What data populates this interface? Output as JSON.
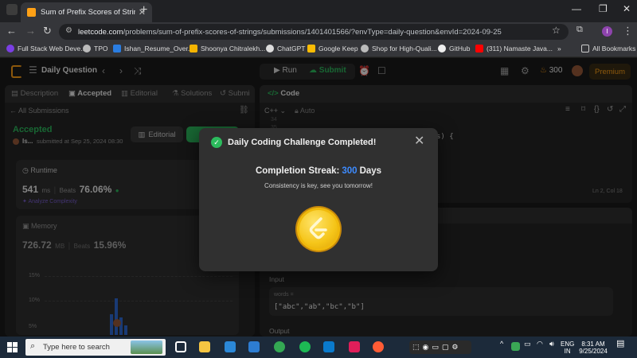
{
  "browser": {
    "tab_title": "Sum of Prefix Scores of Strings",
    "url_host": "leetcode.com",
    "url_path": "/problems/sum-of-prefix-scores-of-strings/submissions/1401401566/?envType=daily-question&envId=2024-09-25",
    "bookmarks": [
      "Full Stack Web Deve...",
      "TPO",
      "Ishan_Resume_Over...",
      "Shoonya Chitralekh...",
      "ChatGPT",
      "Google Keep",
      "Shop for High-Quali...",
      "GitHub",
      "(311) Namaste Java..."
    ],
    "all_bookmarks": "All Bookmarks",
    "more": "»"
  },
  "header": {
    "daily_question": "Daily Question",
    "run": "Run",
    "submit": "Submit",
    "streak_count": "300",
    "premium": "Premium"
  },
  "left_panel": {
    "tabs": [
      "Description",
      "Accepted",
      "Editorial",
      "Solutions",
      "Submi"
    ],
    "all_submissions": "All Submissions",
    "status": "Accepted",
    "user": "Is...",
    "submitted_at": "submitted at Sep 25, 2024 08:30",
    "editorial_btn": "Editorial",
    "runtime_label": "Runtime",
    "runtime_value": "541",
    "runtime_unit": "ms",
    "beats_label": "Beats",
    "runtime_beats": "76.06%",
    "analyze": "Analyze Complexity",
    "memory_label": "Memory",
    "memory_value": "726.72",
    "memory_unit": "MB",
    "memory_beats": "15.96%",
    "axis_ticks": [
      "15%",
      "10%",
      "5%"
    ]
  },
  "right_panel": {
    "code_tab": "Code",
    "language": "C++",
    "auto": "Auto",
    "line_numbers": [
      "34",
      "35"
    ],
    "code_fragment": "s) {",
    "cursor_pos": "Ln 2, Col 18",
    "input_label": "Input",
    "words_label": "words =",
    "words_value": "[\"abc\",\"ab\",\"bc\",\"b\"]",
    "output_label": "Output"
  },
  "modal": {
    "title": "Daily Coding Challenge Completed!",
    "streak_prefix": "Completion Streak:",
    "streak_value": "300",
    "streak_suffix": "Days",
    "subtitle": "Consistency is key, see you tomorrow!"
  },
  "taskbar": {
    "search_placeholder": "Type here to search",
    "lang_top": "ENG",
    "lang_bottom": "IN",
    "time": "8:31 AM",
    "date": "9/25/2024"
  },
  "colors": {
    "accent_green": "#2cbb5d",
    "streak_blue": "#3d8bff",
    "brand_orange": "#ffa116"
  }
}
